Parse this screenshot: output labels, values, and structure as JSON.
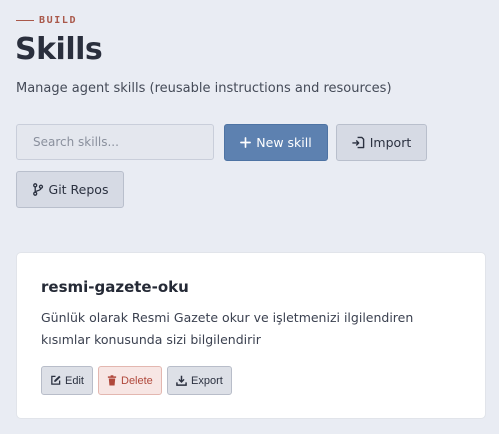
{
  "header": {
    "section_label": "BUILD",
    "title": "Skills",
    "subtitle": "Manage agent skills (reusable instructions and resources)"
  },
  "toolbar": {
    "search_placeholder": "Search skills...",
    "search_value": "",
    "new_skill_label": "New skill",
    "import_label": "Import",
    "git_repos_label": "Git Repos",
    "icons": {
      "new_skill": "plus-icon",
      "import": "import-icon",
      "git_repos": "git-branch-icon"
    }
  },
  "skills": [
    {
      "name": "resmi-gazete-oku",
      "description": "Günlük olarak Resmi Gazete okur ve işletmenizi ilgilendiren kısımlar konusunda sizi bilgilendirir",
      "actions": {
        "edit_label": "Edit",
        "delete_label": "Delete",
        "export_label": "Export"
      }
    }
  ],
  "colors": {
    "accent": "#5d81b0",
    "danger": "#b0483b",
    "background": "#e9ecf3"
  }
}
